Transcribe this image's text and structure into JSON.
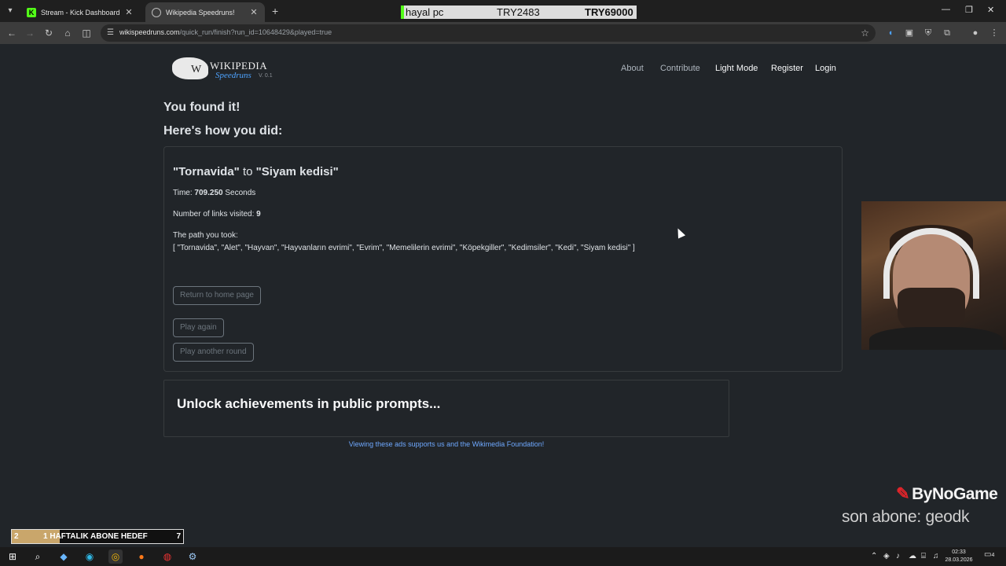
{
  "browser": {
    "tabs": [
      {
        "title": "Stream - Kick Dashboard",
        "favicon": "K"
      },
      {
        "title": "Wikipedia Speedruns!"
      }
    ],
    "url_domain": "wikispeedruns.com",
    "url_path": "/quick_run/finish?run_id=10648429&played=true"
  },
  "overlay": {
    "name": "hayal pc",
    "value1": "TRY2483",
    "value2": "TRY69000"
  },
  "site": {
    "logo_title": "WIKIPEDIA",
    "logo_subtitle": "Speedruns",
    "version": "V. 0.1",
    "nav": {
      "about": "About",
      "contribute": "Contribute",
      "light_mode": "Light Mode",
      "register": "Register",
      "login": "Login"
    }
  },
  "result": {
    "found": "You found it!",
    "how": "Here's how you did:",
    "start": "\"Tornavida\"",
    "to": "to",
    "end": "\"Siyam kedisi\"",
    "time_label": "Time:",
    "time_value": "709.250",
    "time_unit": "Seconds",
    "links_label": "Number of links visited:",
    "links_value": "9",
    "path_label": "The path you took:",
    "path": "[ \"Tornavida\", \"Alet\", \"Hayvan\", \"Hayvanların evrimi\", \"Evrim\", \"Memelilerin evrimi\", \"Köpekgiller\", \"Kedimsiler\", \"Kedi\", \"Siyam kedisi\" ]",
    "buttons": {
      "home": "Return to home page",
      "again": "Play again",
      "another": "Play another round"
    }
  },
  "ad": {
    "text": "Unlock achievements in public prompts...",
    "note": "Viewing these ads supports us and the Wikimedia Foundation!"
  },
  "stream": {
    "brand": "ByNoGame",
    "last_sub": "son abone: geodk",
    "goal_start": "2",
    "goal_text": "1 HAFTALIK ABONE HEDEF",
    "goal_end": "7",
    "goal_progress": 0.28
  },
  "taskbar": {
    "time": "02:33",
    "date": "28.03.2026",
    "notifications": "4"
  },
  "colors": {
    "page_bg": "#212529",
    "link_blue": "#6ea8fe",
    "kick_green": "#53fc18"
  }
}
